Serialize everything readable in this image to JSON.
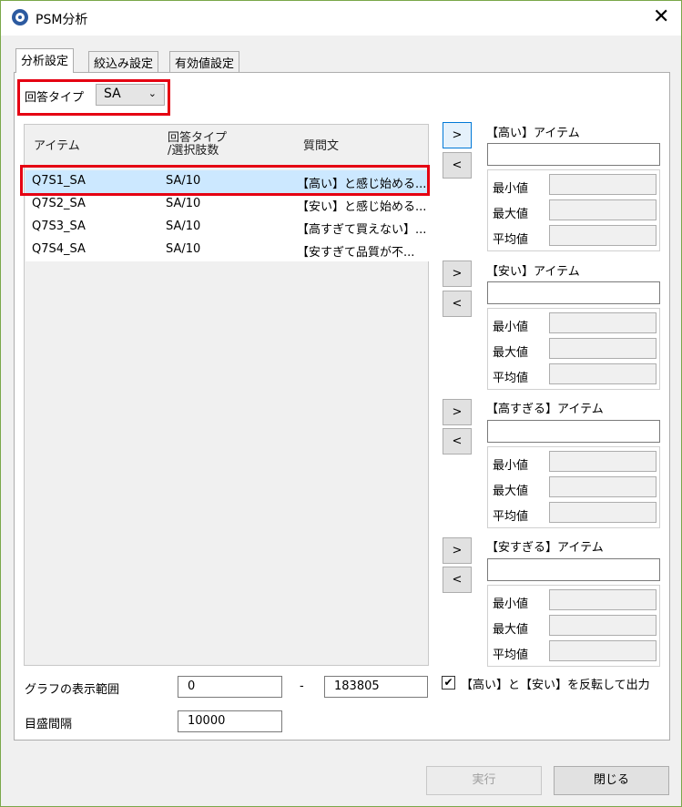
{
  "window": {
    "title": "PSM分析",
    "close": "✕"
  },
  "tabs": [
    {
      "label": "分析設定",
      "active": true
    },
    {
      "label": "絞込み設定",
      "active": false
    },
    {
      "label": "有効値設定",
      "active": false
    }
  ],
  "answer_type": {
    "label": "回答タイプ",
    "value": "SA",
    "chevron": "⌄"
  },
  "list": {
    "headers": {
      "item": "アイテム",
      "type_line1": "回答タイプ",
      "type_line2": "/選択肢数",
      "question": "質問文"
    },
    "rows": [
      {
        "item": "Q7S1_SA",
        "type": "SA/10",
        "question": "【高い】と感じ始める...",
        "selected": true
      },
      {
        "item": "Q7S2_SA",
        "type": "SA/10",
        "question": "【安い】と感じ始める...",
        "selected": false
      },
      {
        "item": "Q7S3_SA",
        "type": "SA/10",
        "question": "【高すぎて買えない】...",
        "selected": false
      },
      {
        "item": "Q7S4_SA",
        "type": "SA/10",
        "question": "【安すぎて品質が不...",
        "selected": false
      }
    ]
  },
  "move_buttons": {
    "add": ">",
    "remove": "<"
  },
  "groups": [
    {
      "title": "【高い】アイテム",
      "value": "",
      "min_label": "最小値",
      "max_label": "最大値",
      "avg_label": "平均値"
    },
    {
      "title": "【安い】アイテム",
      "value": "",
      "min_label": "最小値",
      "max_label": "最大値",
      "avg_label": "平均値"
    },
    {
      "title": "【高すぎる】アイテム",
      "value": "",
      "min_label": "最小値",
      "max_label": "最大値",
      "avg_label": "平均値"
    },
    {
      "title": "【安すぎる】アイテム",
      "value": "",
      "min_label": "最小値",
      "max_label": "最大値",
      "avg_label": "平均値"
    }
  ],
  "graph_range": {
    "label": "グラフの表示範囲",
    "from": "0",
    "sep": "-",
    "to": "183805"
  },
  "interval": {
    "label": "目盛間隔",
    "value": "10000"
  },
  "reverse_option": {
    "checked": true,
    "check_mark": "✔",
    "label": "【高い】と【安い】を反転して出力"
  },
  "footer": {
    "run_label": "実行",
    "close_label": "閉じる"
  },
  "colors": {
    "highlight": "#e50012",
    "selection": "#cce8ff",
    "accent": "#0078d7"
  }
}
